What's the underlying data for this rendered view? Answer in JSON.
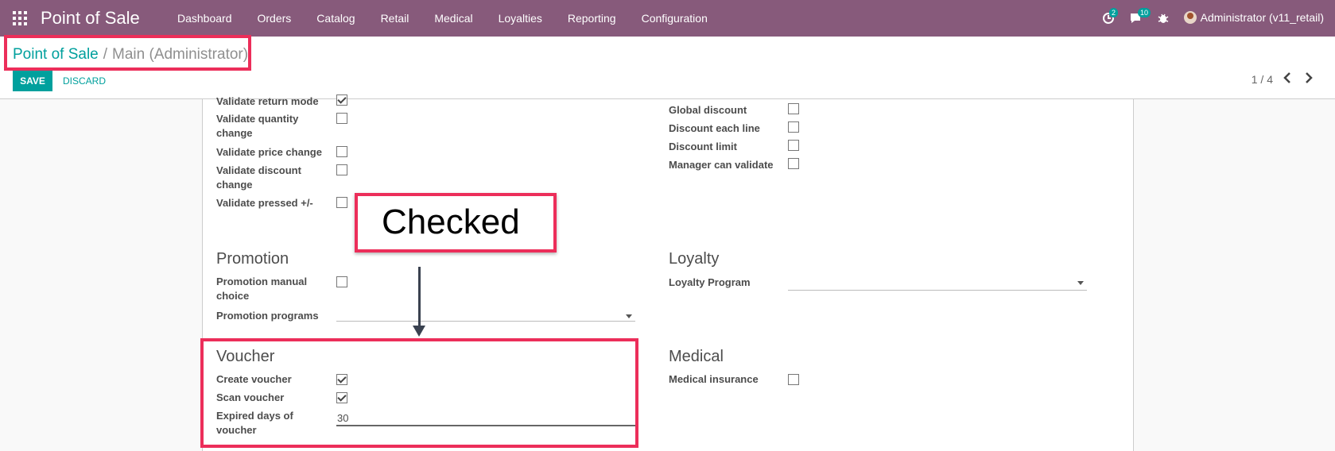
{
  "navbar": {
    "brand": "Point of Sale",
    "menu": [
      "Dashboard",
      "Orders",
      "Catalog",
      "Retail",
      "Medical",
      "Loyalties",
      "Reporting",
      "Configuration"
    ],
    "activity_badge": "2",
    "messages_badge": "10",
    "user": "Administrator (v11_retail)",
    "bg_color": "#875a7b"
  },
  "breadcrumb": {
    "parent": "Point of Sale",
    "separator": "/",
    "current": "Main (Administrator)"
  },
  "buttons": {
    "save": "SAVE",
    "discard": "DISCARD"
  },
  "pager": {
    "text": "1 / 4",
    "prev": "‹",
    "next": "›"
  },
  "left_fields": [
    {
      "label": "Validate return mode",
      "checked": true
    },
    {
      "label": "Validate quantity change",
      "checked": false
    },
    {
      "label": "Validate price change",
      "checked": false
    },
    {
      "label": "Validate discount change",
      "checked": false
    },
    {
      "label": "Validate pressed +/-",
      "checked": false
    }
  ],
  "right_fields": [
    {
      "label": "Global discount",
      "checked": false
    },
    {
      "label": "Discount each line",
      "checked": false
    },
    {
      "label": "Discount limit",
      "checked": false
    },
    {
      "label": "Manager can validate",
      "checked": false
    }
  ],
  "promotion": {
    "title": "Promotion",
    "manual_choice_label": "Promotion manual choice",
    "manual_choice_checked": false,
    "programs_label": "Promotion programs",
    "programs_value": ""
  },
  "loyalty": {
    "title": "Loyalty",
    "program_label": "Loyalty Program",
    "program_value": ""
  },
  "voucher": {
    "title": "Voucher",
    "create_label": "Create voucher",
    "create_checked": true,
    "scan_label": "Scan voucher",
    "scan_checked": true,
    "expired_label": "Expired days of voucher",
    "expired_value": "30"
  },
  "medical": {
    "title": "Medical",
    "insurance_label": "Medical insurance",
    "insurance_checked": false
  },
  "annotation": {
    "text": "Checked",
    "color": "#ec2e5a"
  },
  "colors": {
    "accent": "#00a09d",
    "highlight": "#ec2e5a"
  }
}
